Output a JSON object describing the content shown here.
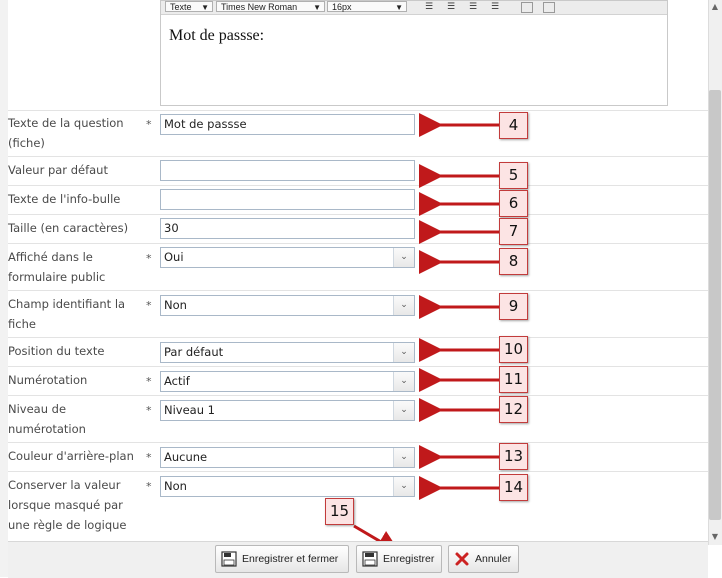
{
  "editor": {
    "toolbar": {
      "format_select": "Texte",
      "font_select": "Times New Roman",
      "size_select": "16px"
    },
    "content": "Mot de passse:"
  },
  "form": {
    "rows": [
      {
        "label": "Texte de la question (fiche)",
        "required": "*",
        "type": "input",
        "value": "Mot de passse"
      },
      {
        "label": "Valeur par défaut",
        "required": "",
        "type": "input",
        "value": ""
      },
      {
        "label": "Texte de l'info-bulle",
        "required": "",
        "type": "input",
        "value": ""
      },
      {
        "label": "Taille (en caractères)",
        "required": "",
        "type": "input",
        "value": "30"
      },
      {
        "label": "Affiché dans le formulaire public",
        "required": "*",
        "type": "select",
        "value": "Oui"
      },
      {
        "label": "Champ identifiant la fiche",
        "required": "*",
        "type": "select",
        "value": "Non"
      },
      {
        "label": "Position du texte",
        "required": "",
        "type": "select",
        "value": "Par défaut"
      },
      {
        "label": "Numérotation",
        "required": "*",
        "type": "select",
        "value": "Actif"
      },
      {
        "label": "Niveau de numérotation",
        "required": "*",
        "type": "select",
        "value": "Niveau 1"
      },
      {
        "label": "Couleur d'arrière-plan",
        "required": "*",
        "type": "select",
        "value": "Aucune"
      },
      {
        "label": "Conserver la valeur lorsque masqué par une règle de logique",
        "required": "*",
        "type": "select",
        "value": "Non"
      }
    ]
  },
  "callouts": [
    "4",
    "5",
    "6",
    "7",
    "8",
    "9",
    "10",
    "11",
    "12",
    "13",
    "14",
    "15"
  ],
  "footer": {
    "save_close_label": "Enregistrer et fermer",
    "save_label": "Enregistrer",
    "cancel_label": "Annuler"
  },
  "colors": {
    "arrow": "#c0191b",
    "callout_border": "#c23b3b",
    "callout_bg": "#fce4e4"
  }
}
